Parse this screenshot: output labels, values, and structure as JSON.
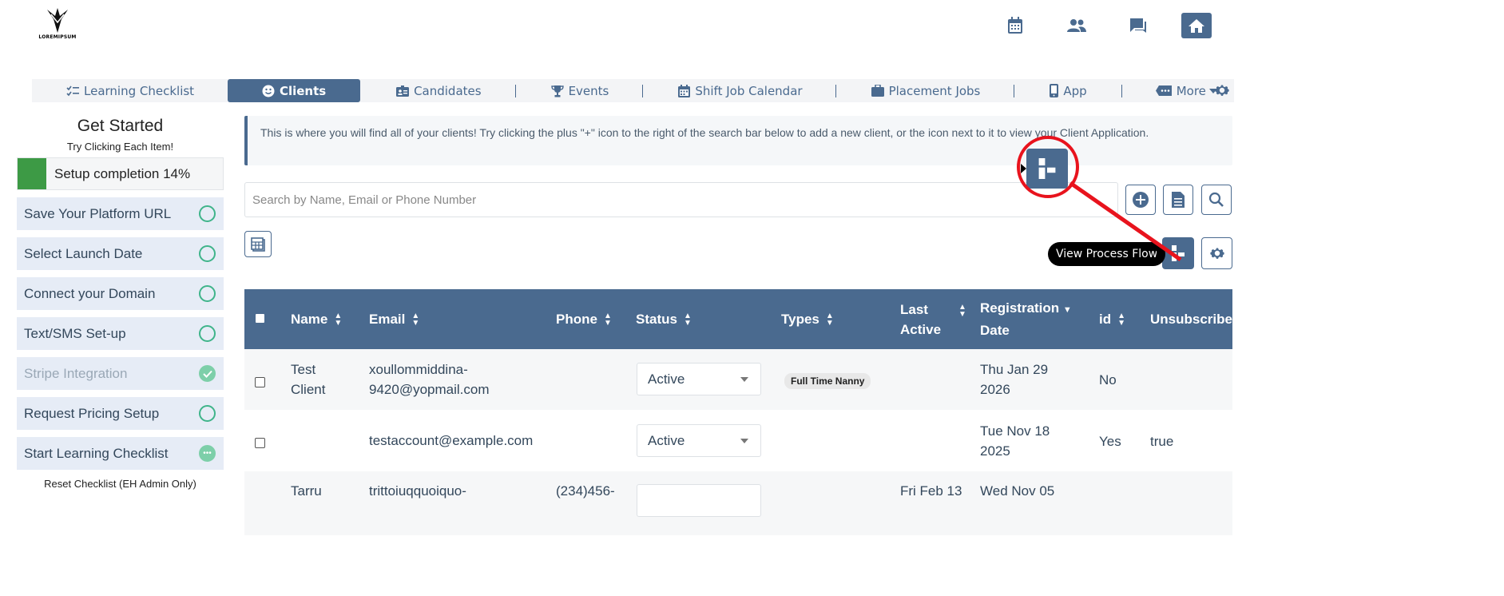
{
  "brand": {
    "logo_text": "LOREMIPSUM"
  },
  "nav": {
    "items": [
      {
        "label": "Learning Checklist",
        "icon": "checklist-icon"
      },
      {
        "label": "Clients",
        "icon": "smile-icon"
      },
      {
        "label": "Candidates",
        "icon": "id-badge-icon"
      },
      {
        "label": "Events",
        "icon": "trophy-icon"
      },
      {
        "label": "Shift Job Calendar",
        "icon": "calendar-icon"
      },
      {
        "label": "Placement Jobs",
        "icon": "briefcase-icon"
      },
      {
        "label": "App",
        "icon": "mobile-icon"
      },
      {
        "label": "More",
        "icon": "tag-icon"
      }
    ],
    "active": "Clients"
  },
  "sidebar": {
    "title": "Get Started",
    "subtitle": "Try Clicking Each Item!",
    "progress_label": "Setup completion 14%",
    "progress_value": 0.14,
    "steps": [
      {
        "label": "Save Your Platform URL",
        "state": "todo"
      },
      {
        "label": "Select Launch Date",
        "state": "todo"
      },
      {
        "label": "Connect your Domain",
        "state": "todo"
      },
      {
        "label": "Text/SMS Set-up",
        "state": "todo"
      },
      {
        "label": "Stripe Integration",
        "state": "done"
      },
      {
        "label": "Request Pricing Setup",
        "state": "todo"
      },
      {
        "label": "Start Learning Checklist",
        "state": "in-progress"
      }
    ],
    "reset_label": "Reset Checklist (EH Admin Only)"
  },
  "info_text": "This is where you will find all of your clients! Try clicking the plus \"+\" icon to the right of the search bar below to add a new client, or the icon next to it to view your Client Application.",
  "search": {
    "placeholder": "Search by Name, Email or Phone Number"
  },
  "tooltip": "View Process Flow",
  "table": {
    "headers": {
      "name": "Name",
      "email": "Email",
      "phone": "Phone",
      "status": "Status",
      "types": "Types",
      "last_active_1": "Last",
      "last_active_2": "Active",
      "reg_1": "Registration",
      "reg_2": "Date",
      "id": "id",
      "unsub": "Unsubscribed"
    },
    "rows": [
      {
        "name_1": "Test",
        "name_2": "Client",
        "email_1": "xoullommiddina-",
        "email_2": "9420@yopmail.com",
        "phone": "",
        "status": "Active",
        "type": "Full Time Nanny",
        "last_active": "",
        "reg_1": "Thu Jan 29",
        "reg_2": "2026",
        "id": "No",
        "unsub": ""
      },
      {
        "name_1": "",
        "name_2": "",
        "email_1": "testaccount@example.com",
        "email_2": "",
        "phone": "",
        "status": "Active",
        "type": "",
        "last_active": "",
        "reg_1": "Tue Nov 18",
        "reg_2": "2025",
        "id": "Yes",
        "unsub": "true"
      },
      {
        "name_1": "Tarru",
        "name_2": "",
        "email_1": "trittoiuqquoiquo-",
        "email_2": "",
        "phone": "(234)456-",
        "status": "",
        "type": "",
        "last_active": "Fri Feb 13",
        "reg_1": "Wed Nov 05",
        "reg_2": "",
        "id": "",
        "unsub": ""
      }
    ]
  },
  "colors": {
    "primary": "#4a6a8f",
    "success": "#3d9a45",
    "highlight": "#e8131d"
  }
}
